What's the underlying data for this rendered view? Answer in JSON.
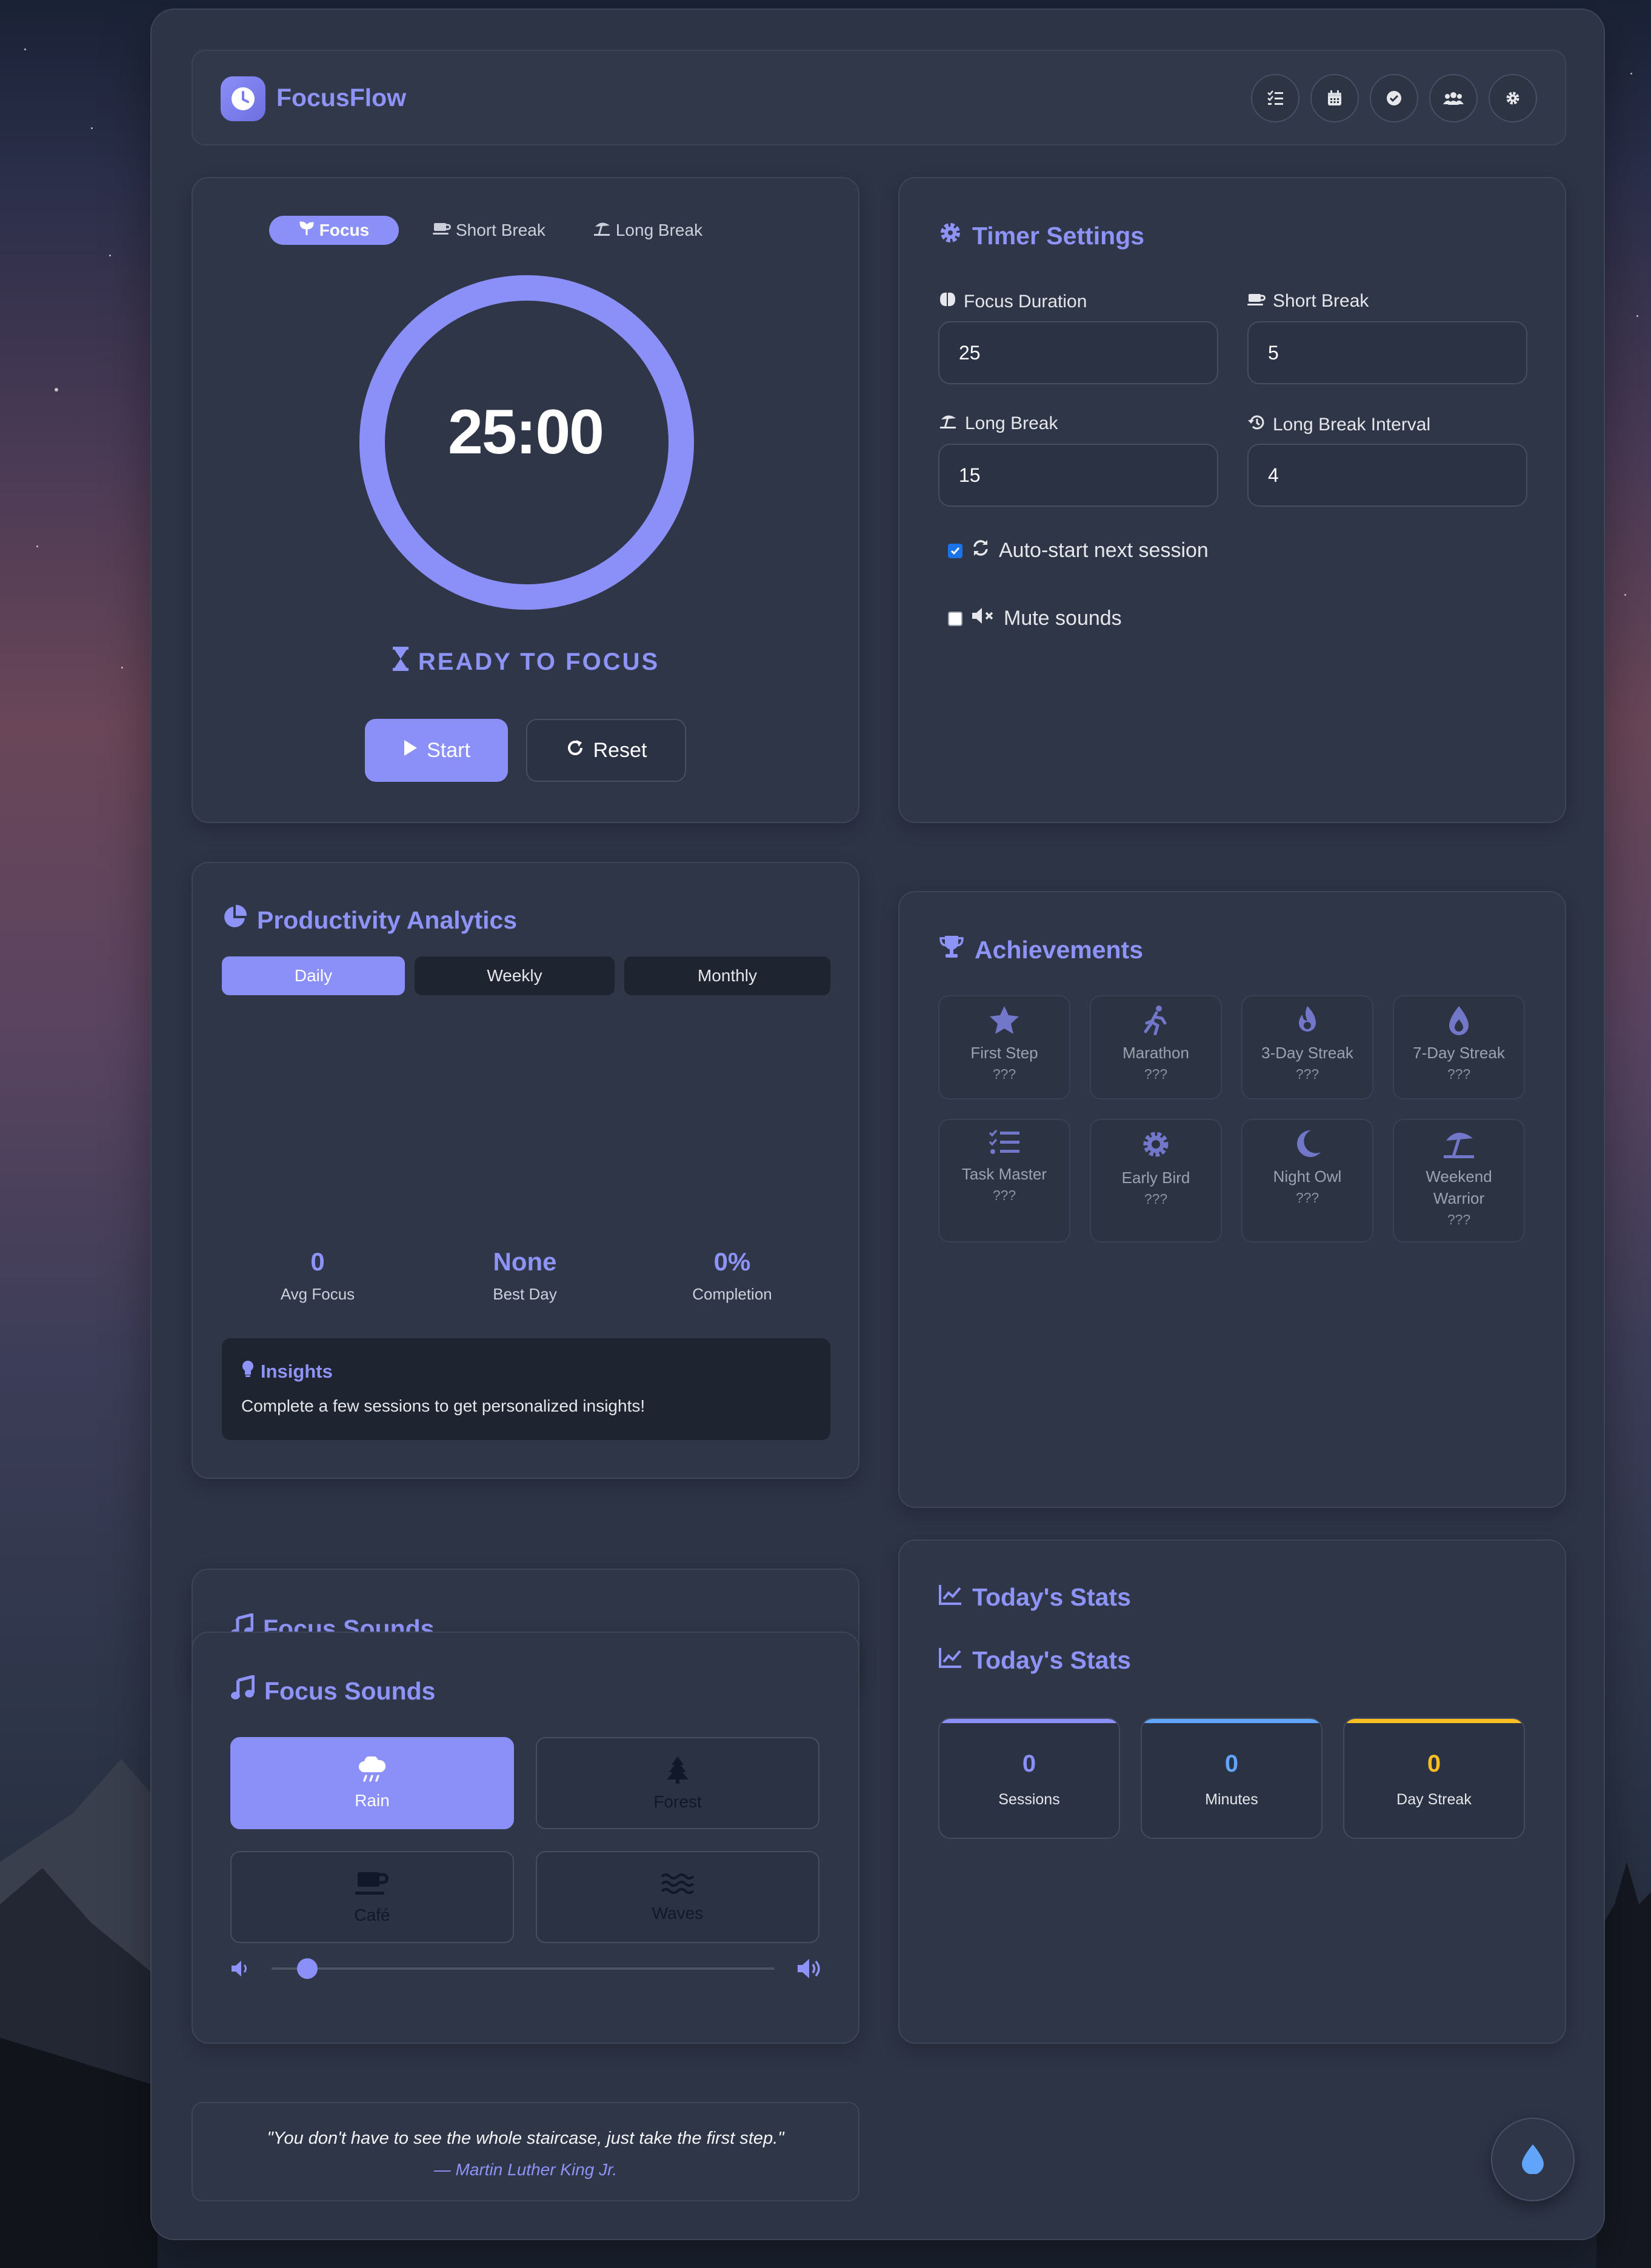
{
  "app": {
    "title": "FocusFlow"
  },
  "header_icons": [
    "tasks-icon",
    "calendar-icon",
    "check-circle-icon",
    "users-icon",
    "settings-icon"
  ],
  "timer": {
    "tabs": [
      {
        "label": "Focus",
        "icon": "seedling-icon",
        "active": true
      },
      {
        "label": "Short Break",
        "icon": "coffee-icon",
        "active": false
      },
      {
        "label": "Long Break",
        "icon": "umbrella-beach-icon",
        "active": false
      }
    ],
    "time": "25:00",
    "status": "READY TO FOCUS",
    "progress": 1.0,
    "start_label": "Start",
    "reset_label": "Reset"
  },
  "settings": {
    "title": "Timer Settings",
    "focus_label": "Focus Duration",
    "focus_value": "25",
    "short_label": "Short Break",
    "short_value": "5",
    "long_label": "Long Break",
    "long_value": "15",
    "interval_label": "Long Break Interval",
    "interval_value": "4",
    "auto_start_label": "Auto-start next session",
    "auto_start_checked": true,
    "mute_label": "Mute sounds",
    "mute_checked": false
  },
  "analytics": {
    "title": "Productivity Analytics",
    "tabs": [
      "Daily",
      "Weekly",
      "Monthly"
    ],
    "active_tab": "Daily",
    "stats": [
      {
        "value": "0",
        "label": "Avg Focus"
      },
      {
        "value": "None",
        "label": "Best Day"
      },
      {
        "value": "0%",
        "label": "Completion"
      }
    ],
    "insights_title": "Insights",
    "insights_text": "Complete a few sessions to get personalized insights!"
  },
  "achievements": {
    "title": "Achievements",
    "items": [
      {
        "name": "First Step",
        "status": "???",
        "icon": "star-icon"
      },
      {
        "name": "Marathon",
        "status": "???",
        "icon": "running-icon"
      },
      {
        "name": "3-Day Streak",
        "status": "???",
        "icon": "fire-icon"
      },
      {
        "name": "7-Day Streak",
        "status": "???",
        "icon": "flame-drop-icon"
      },
      {
        "name": "Task Master",
        "status": "???",
        "icon": "task-list-icon"
      },
      {
        "name": "Early Bird",
        "status": "???",
        "icon": "sun-icon"
      },
      {
        "name": "Night Owl",
        "status": "???",
        "icon": "moon-icon"
      },
      {
        "name": "Weekend Warrior",
        "status": "???",
        "icon": "umbrella-beach-icon"
      }
    ]
  },
  "sounds": {
    "title": "Focus Sounds",
    "hidden_title": "Focus Sounds",
    "items": [
      {
        "label": "Rain",
        "icon": "cloud-rain-icon",
        "active": true
      },
      {
        "label": "Forest",
        "icon": "tree-icon",
        "active": false
      },
      {
        "label": "Café",
        "icon": "mug-icon",
        "active": false
      },
      {
        "label": "Waves",
        "icon": "water-icon",
        "active": false
      }
    ],
    "volume": 0.05
  },
  "today": {
    "title_1": "Today's Stats",
    "title_2": "Today's Stats",
    "stats": [
      {
        "value": "0",
        "label": "Sessions",
        "color": "#8b8ff8"
      },
      {
        "value": "0",
        "label": "Minutes",
        "color": "#60a5fa"
      },
      {
        "value": "0",
        "label": "Day Streak",
        "color": "#fbbf24"
      }
    ]
  },
  "quote": {
    "text": "\"You don't have to see the whole staircase, just take the first step.\"",
    "author": "— Martin Luther King Jr."
  },
  "fab_icon": "water-drop-icon",
  "colors": {
    "accent": "#8b8ff8",
    "card": "#2f3647",
    "panel": "#2d3446"
  }
}
